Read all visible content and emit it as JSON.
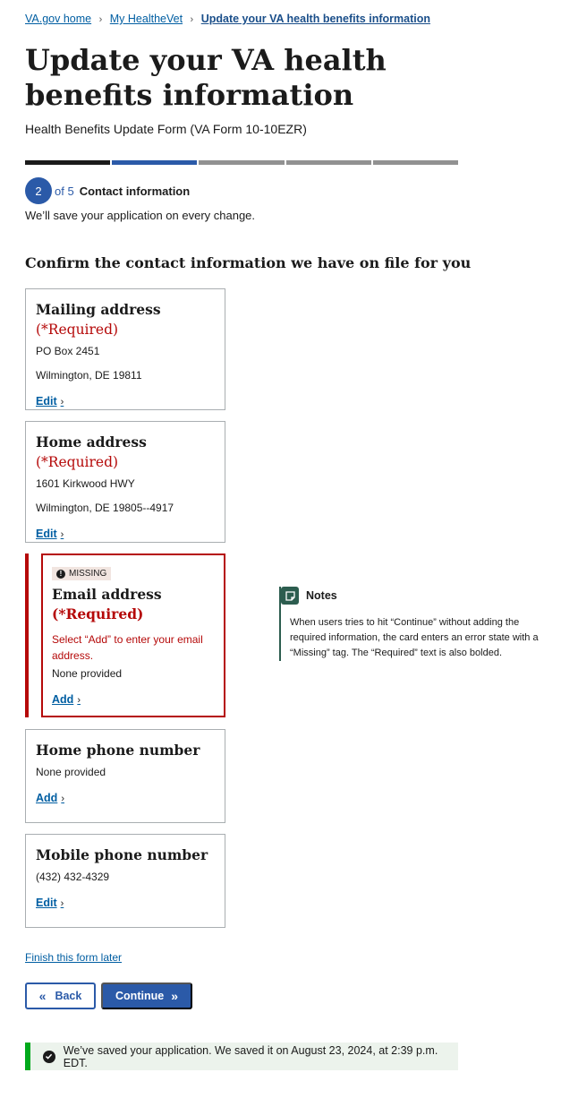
{
  "breadcrumb": {
    "items": [
      "VA.gov home",
      "My HealtheVet"
    ],
    "current": "Update your VA health benefits information",
    "separator": "›"
  },
  "page": {
    "title": "Update your VA health benefits information",
    "subtitle": "Health Benefits Update Form (VA Form 10-10EZR)"
  },
  "progress": {
    "total": 5,
    "current": 2
  },
  "step": {
    "number": "2",
    "of": "of 5",
    "label": "Contact information",
    "save_note": "We’ll save your application on every change."
  },
  "section": {
    "heading": "Confirm the contact information we have on file for you"
  },
  "cards": {
    "mailing": {
      "title": "Mailing address",
      "required": "(*Required)",
      "line1": "PO Box 2451",
      "line2": "Wilmington, DE 19811",
      "action": "Edit"
    },
    "home": {
      "title": "Home address",
      "required": "(*Required)",
      "line1": "1601 Kirkwood HWY",
      "line2": "Wilmington, DE 19805--4917",
      "action": "Edit"
    },
    "email": {
      "tag": "MISSING",
      "title": "Email address",
      "required": "(*Required)",
      "error": "Select “Add” to enter your email address.",
      "value": "None provided",
      "action": "Add"
    },
    "home_phone": {
      "title": "Home phone number",
      "value": "None provided",
      "action": "Add"
    },
    "mobile_phone": {
      "title": "Mobile phone number",
      "value": "(432) 432-4329",
      "action": "Edit"
    }
  },
  "notes": {
    "title": "Notes",
    "body": "When users tries to hit “Continue” without adding the required information, the card enters an error state with a “Missing” tag. The “Required” text is also bolded."
  },
  "footer": {
    "finish_later": "Finish this form later",
    "back": "Back",
    "continue": "Continue",
    "saved_message": "We’ve saved your application. We saved it on August 23, 2024, at 2:39 p.m. EDT."
  },
  "colors": {
    "primary": "#2b5aa8",
    "error": "#b50909",
    "success": "#00a91c",
    "notes": "#2c5d4f"
  },
  "icons": {
    "chevron": "›",
    "back": "«",
    "forward": "»",
    "missing": "exclamation-circle-icon",
    "success": "check-circle-icon",
    "notes": "note-icon"
  }
}
